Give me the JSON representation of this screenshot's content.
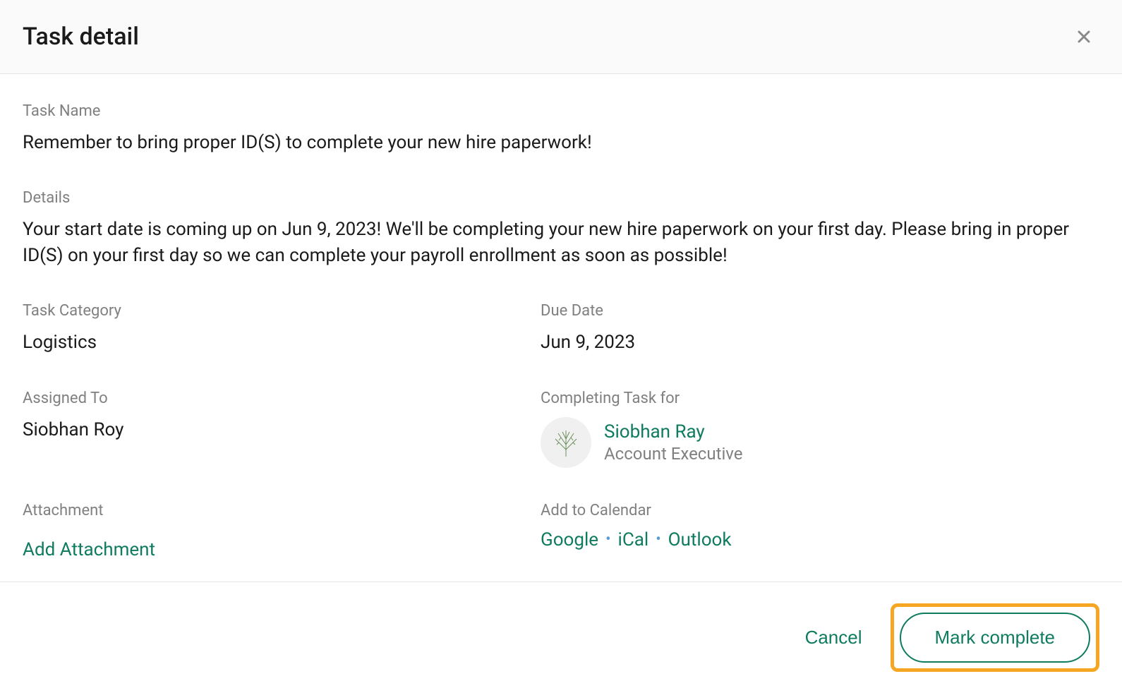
{
  "header": {
    "title": "Task detail"
  },
  "fields": {
    "task_name_label": "Task Name",
    "task_name_value": "Remember to bring proper ID(S) to complete your new hire paperwork!",
    "details_label": "Details",
    "details_value": "Your start date is coming up on Jun 9, 2023! We'll be completing your new hire paperwork on your first day. Please bring in proper ID(S) on your first day so we can complete your payroll enrollment as soon as possible!",
    "task_category_label": "Task Category",
    "task_category_value": "Logistics",
    "due_date_label": "Due Date",
    "due_date_value": "Jun 9, 2023",
    "assigned_to_label": "Assigned To",
    "assigned_to_value": "Siobhan Roy",
    "completing_for_label": "Completing Task for",
    "completing_for_name": "Siobhan Ray",
    "completing_for_title": "Account Executive",
    "attachment_label": "Attachment",
    "attachment_action": "Add Attachment",
    "calendar_label": "Add to Calendar",
    "calendar_google": "Google",
    "calendar_ical": "iCal",
    "calendar_outlook": "Outlook"
  },
  "footer": {
    "cancel": "Cancel",
    "mark_complete": "Mark complete"
  }
}
